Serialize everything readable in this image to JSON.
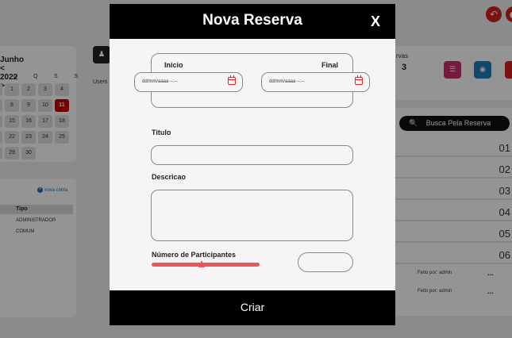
{
  "background": {
    "calendar": {
      "month": "Junho",
      "prev": "<",
      "year": "2022",
      "next": ">",
      "weekdays": [
        "Q",
        "Q",
        "S",
        "S"
      ],
      "rows": [
        [
          "",
          "1",
          "2",
          "3",
          "4"
        ],
        [
          "",
          "8",
          "9",
          "10",
          "11"
        ],
        [
          "",
          "15",
          "16",
          "17",
          "18"
        ],
        [
          "",
          "22",
          "23",
          "24",
          "25"
        ],
        [
          "",
          "29",
          "30",
          "",
          ""
        ]
      ],
      "today": "11"
    },
    "users_label": "Users",
    "stat_label": "rvas",
    "stat_value": "3",
    "search_placeholder": "Busca Pela Reserva",
    "numbers": [
      "01",
      "02",
      "03",
      "04",
      "05",
      "06"
    ],
    "feito": [
      {
        "text": "Feito por: admin",
        "dots": "..."
      },
      {
        "text": "Feito por: admin",
        "dots": "..."
      }
    ],
    "nova_conta": "nova conta",
    "tipo_header": "Tipo",
    "tipo_rows": [
      "ADMINISTRADOR",
      "COMUM"
    ],
    "colors": {
      "accent_red": "#d42020",
      "pink": "#cc2e6e",
      "blue": "#1c7fb6"
    }
  },
  "modal": {
    "title": "Nova Reserva",
    "close": "X",
    "inicio_label": "Inicio",
    "final_label": "Final",
    "date_placeholder": "dd/mm/aaaa --:--",
    "titulo_label": "Titulo",
    "descricao_label": "Descricao",
    "participantes_label": "Número de Participantes",
    "participantes_slider_fraction": 0.42,
    "submit": "Criar"
  }
}
